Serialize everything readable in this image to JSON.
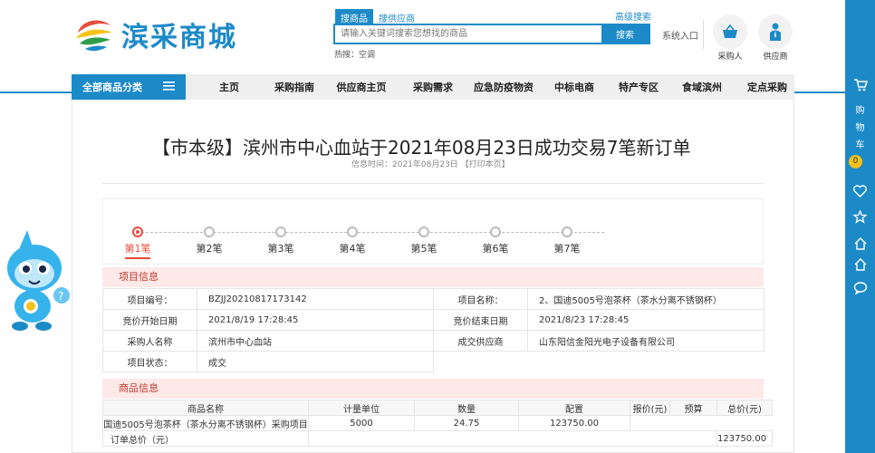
{
  "header": {
    "logo_text": "滨采商城",
    "search_tabs": [
      "搜商品",
      "搜供应商"
    ],
    "advanced_search": "高级搜索",
    "search_placeholder": "请输入关键词搜索您想找的商品",
    "search_button": "搜索",
    "hot_words": "热搜：空调",
    "system_entry": "系统入口",
    "roles": [
      "采购人",
      "供应商"
    ]
  },
  "nav": {
    "all_categories": "全部商品分类",
    "items": [
      "主页",
      "采购指南",
      "供应商主页",
      "采购需求",
      "应急防疫物资",
      "中标电商",
      "特产专区",
      "食域滨州",
      "定点采购"
    ]
  },
  "article": {
    "title": "【市本级】滨州市中心血站于2021年08月23日成功交易7笔新订单",
    "info": "信息时间：2021年08月23日 【打印本页】"
  },
  "steps": [
    "第1笔",
    "第2笔",
    "第3笔",
    "第4笔",
    "第5笔",
    "第6笔",
    "第7笔"
  ],
  "project_section": {
    "heading": "项目信息",
    "rows": [
      {
        "k1": "项目编号：",
        "v1": "BZJJ20210817173142",
        "k2": "项目名称：",
        "v2": "2、国迪5005号泡茶杯（茶水分离不锈钢杯）"
      },
      {
        "k1": "竞价开始日期",
        "v1": "2021/8/19 17:28:45",
        "k2": "竞价结束日期",
        "v2": "2021/8/23 17:28:45"
      },
      {
        "k1": "采购人名称",
        "v1": "滨州市中心血站",
        "k2": "成交供应商",
        "v2": "山东阳信金阳光电子设备有限公司"
      },
      {
        "k1": "项目状态：",
        "v1": "成交"
      }
    ]
  },
  "goods_section": {
    "heading": "商品信息",
    "headers": [
      "商品名称",
      "计量单位",
      "数量",
      "配置",
      "报价(元)",
      "预算",
      "总价(元)"
    ],
    "row": [
      "国迪5005号泡茶杯（茶水分离不锈钢杯）采购项目",
      "5000",
      "24.75",
      "123750.00"
    ],
    "total_label": "订单总价（元）",
    "total_value": "123750.00"
  },
  "sidebar": {
    "cart_label": [
      "购",
      "物",
      "车"
    ],
    "cart_count": "0"
  },
  "colors": {
    "primary": "#1d8ac8",
    "accent": "#e84b3c",
    "section_bg": "#fde9e8"
  }
}
